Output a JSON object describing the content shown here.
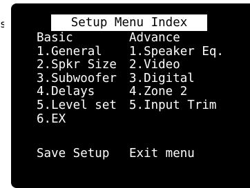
{
  "edge_text": "s",
  "menu": {
    "title": "Setup Menu Index",
    "basic": {
      "header": "Basic",
      "items": [
        "1.General",
        "2.Spkr Size",
        "3.Subwoofer",
        "4.Delays",
        "5.Level set",
        "6.EX"
      ]
    },
    "advance": {
      "header": "Advance",
      "items": [
        "1.Speaker Eq.",
        "2.Video",
        "3.Digital",
        "4.Zone 2",
        "5.Input Trim"
      ]
    },
    "save_label": "Save Setup",
    "exit_label": "Exit menu"
  }
}
